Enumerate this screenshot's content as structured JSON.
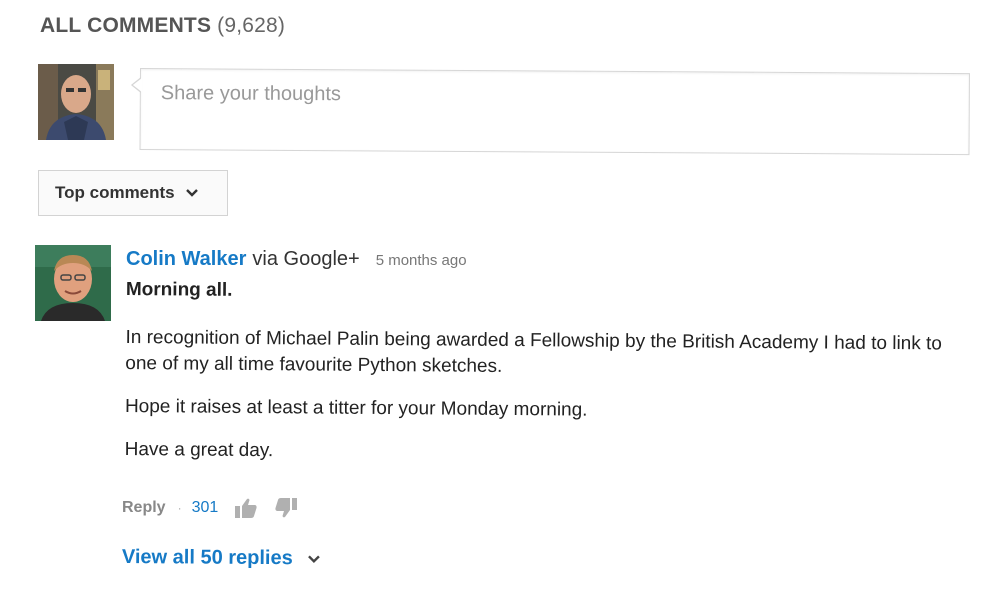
{
  "header": {
    "title": "ALL COMMENTS",
    "count": "(9,628)"
  },
  "composer": {
    "placeholder": "Share your thoughts"
  },
  "sort": {
    "label": "Top comments",
    "icon": "chevron-down-icon"
  },
  "comment": {
    "author": "Colin Walker",
    "via": "via Google+",
    "time": "5 months ago",
    "paragraphs": [
      "Morning all.",
      "In recognition of Michael Palin being awarded a Fellowship by the British Academy I had to link to one of my all time favourite Python sketches.",
      "Hope it raises at least a titter for your Monday morning.",
      "Have a great day."
    ],
    "reply_label": "Reply",
    "separator": "·",
    "likes": "301",
    "like_icon": "thumbs-up-icon",
    "dislike_icon": "thumbs-down-icon"
  },
  "replies": {
    "label": "View all 50 replies",
    "icon": "chevron-down-icon"
  },
  "colors": {
    "link": "#167ac6",
    "muted": "#888888"
  }
}
